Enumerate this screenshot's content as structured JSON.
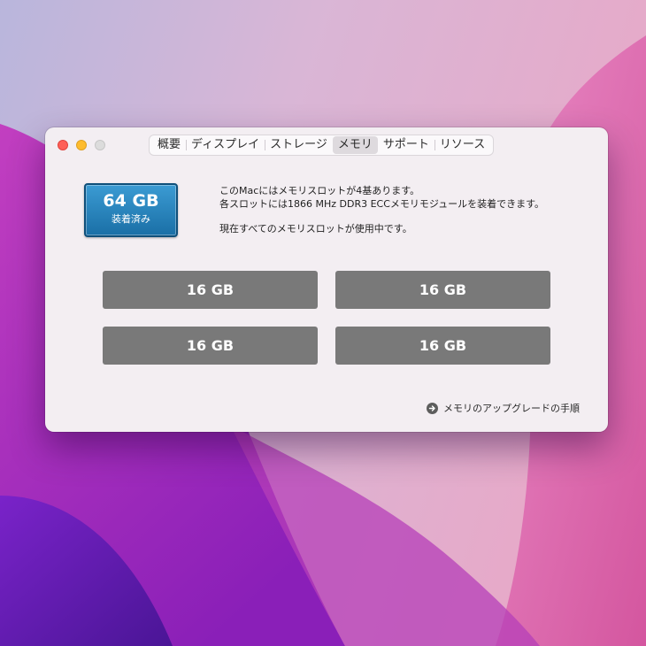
{
  "window": {
    "tabs": [
      {
        "label": "概要",
        "selected": false
      },
      {
        "label": "ディスプレイ",
        "selected": false
      },
      {
        "label": "ストレージ",
        "selected": false
      },
      {
        "label": "メモリ",
        "selected": true
      },
      {
        "label": "サポート",
        "selected": false
      },
      {
        "label": "リソース",
        "selected": false
      }
    ]
  },
  "memory": {
    "total": "64 GB",
    "installed_label": "装着済み",
    "info_line1": "このMacにはメモリスロットが4基あります。",
    "info_line2": "各スロットには1866 MHz DDR3 ECCメモリモジュールを装着できます。",
    "info_line3": "現在すべてのメモリスロットが使用中です。",
    "slots": [
      "16 GB",
      "16 GB",
      "16 GB",
      "16 GB"
    ],
    "upgrade_link": "メモリのアップグレードの手順"
  },
  "colors": {
    "badge": "#2683bd",
    "slot": "#797979",
    "close": "#fe5f57",
    "minimize": "#febc2e"
  },
  "icons": {
    "upgrade_link_icon": "arrow-right-circle-icon"
  }
}
